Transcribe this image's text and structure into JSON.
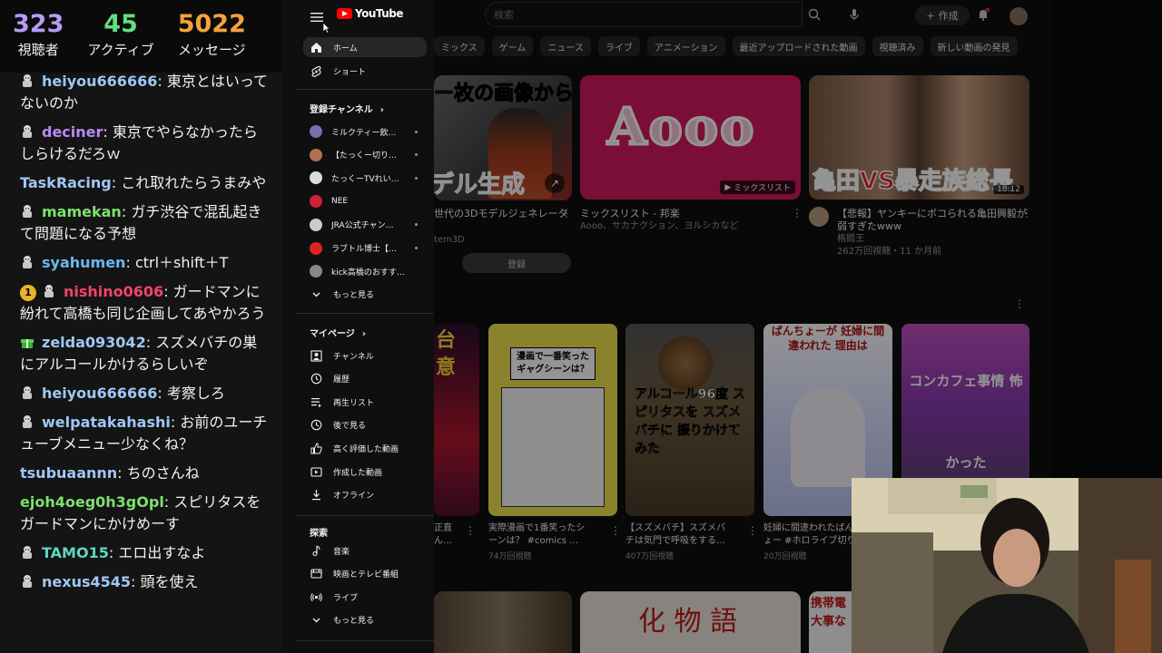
{
  "stats": [
    {
      "value": "323",
      "label": "視聴者",
      "color": "#b79af7"
    },
    {
      "value": "45",
      "label": "アクティブ",
      "color": "#5ee07f"
    },
    {
      "value": "5022",
      "label": "メッセージ",
      "color": "#f4a23c"
    }
  ],
  "chat": [
    {
      "user": "heiyou666666",
      "text": "東京とはいってないのか",
      "color": "#9fc7f5",
      "icon": "avatar"
    },
    {
      "user": "deciner",
      "text": "東京でやらなかったらしらけるだろｗ",
      "color": "#b88af5",
      "icon": "avatar"
    },
    {
      "user": "TaskRacing",
      "text": "これ取れたらうまみや",
      "color": "#9fc7f5",
      "icon": ""
    },
    {
      "user": "mamekan",
      "text": "ガチ渋谷で混乱起きて問題になる予想",
      "color": "#7ee06f",
      "icon": "avatar"
    },
    {
      "user": "syahumen",
      "text": "ctrl＋shift＋T",
      "color": "#6bb8f0",
      "icon": "avatar"
    },
    {
      "user": "nishino0606",
      "text": "ガードマンに紛れて高橋も同じ企画してあやかろう",
      "color": "#f0456a",
      "icon": "avatar",
      "badge": "1"
    },
    {
      "user": "zelda093042",
      "text": "スズメバチの巣にアルコールかけるらしいぞ",
      "color": "#9fc7f5",
      "icon": "gift"
    },
    {
      "user": "heiyou666666",
      "text": "考察しろ",
      "color": "#9fc7f5",
      "icon": "avatar"
    },
    {
      "user": "welpatakahashi",
      "text": "お前のユーチューブメニュー少なくね？",
      "color": "#9fc7f5",
      "icon": "avatar"
    },
    {
      "user": "tsubuaannn",
      "text": "ちのさんね",
      "color": "#9fc7f5",
      "icon": ""
    },
    {
      "user": "ejoh4oeg0h3gOpl",
      "text": "スピリタスをガードマンにかけめーす",
      "color": "#7ee06f",
      "icon": ""
    },
    {
      "user": "TAMO15",
      "text": "エロ出すなよ",
      "color": "#5fd6c2",
      "icon": "avatar"
    },
    {
      "user": "nexus4545",
      "text": "頭を使え",
      "color": "#9fc7f5",
      "icon": "avatar"
    }
  ],
  "youtube": {
    "logo_text": "YouTube",
    "search_placeholder": "検索",
    "create_label": "作成",
    "chips": [
      "ミックス",
      "ゲーム",
      "ニュース",
      "ライブ",
      "アニメーション",
      "最近アップロードされた動画",
      "視聴済み",
      "新しい動画の発見"
    ],
    "sidebar": {
      "home": "ホーム",
      "shorts": "ショート",
      "subs_header": "登録チャンネル",
      "channels": [
        {
          "name": "ミルクティー飲…",
          "color": "#7a6ea8",
          "live": true
        },
        {
          "name": "【たっくー切り…",
          "color": "#b07050",
          "live": true
        },
        {
          "name": "たっくーTVれい…",
          "color": "#dddddd",
          "live": true
        },
        {
          "name": "NEE",
          "color": "#cc2233",
          "live": false
        },
        {
          "name": "JRA公式チャン…",
          "color": "#cccccc",
          "live": true
        },
        {
          "name": "ラブトル博士【…",
          "color": "#dd2222",
          "live": true
        },
        {
          "name": "kick高橋のおすす…",
          "color": "#888888",
          "live": false
        }
      ],
      "more1": "もっと見る",
      "mypage_header": "マイページ",
      "mypage": [
        "チャンネル",
        "履歴",
        "再生リスト",
        "後で見る",
        "高く評価した動画",
        "作成した動画",
        "オフライン"
      ],
      "explore_header": "探索",
      "explore": [
        "音楽",
        "映画とテレビ番組",
        "ライブ",
        "もっと見る"
      ]
    },
    "videos": [
      {
        "title": "世代の3Dモデルジェネレータ",
        "meta": "tem3D",
        "thumb_text1": "ー枚の画像から",
        "thumb_text2": "デル生成"
      },
      {
        "title": "ミックスリスト - 邦楽",
        "meta": "Aooo、サカナクション、ヨルシカなど",
        "thumb_text": "Aooo",
        "badge": "ミックスリスト"
      },
      {
        "title": "【悲報】ヤンキーにボコられる亀田興毅が",
        "title2": "弱すぎたwww",
        "channel": "格闘王",
        "meta": "262万回視聴・11 か月前",
        "thumb_text": "亀田VS暴走族総長",
        "duration": "18:12"
      }
    ],
    "subscribe_label": "登録",
    "shorts": [
      {
        "title": "正直",
        "title2": "ん…",
        "views": "",
        "thumb_text": "台 意"
      },
      {
        "title": "実際漫画で1番笑ったシ",
        "title2": "ーンは？ #comics …",
        "views": "74万回視聴",
        "thumb_text": "漫画で一番笑った ギャグシーンは？"
      },
      {
        "title": "【スズメバチ】スズメバ",
        "title2": "チは気門で呼吸をする…",
        "views": "407万回視聴",
        "thumb_text": "アルコール96度 スピリタスを スズメバチに 振りかけてみた"
      },
      {
        "title": "妊婦に間違われたばん",
        "title2": "ょー #ホロライブ切り",
        "views": "20万回視聴",
        "thumb_text": "ばんちょーが 妊婦に間違われた 理由は"
      },
      {
        "title": "",
        "title2": "",
        "views": "",
        "thumb_text": "コンカフェ事情 怖かった"
      }
    ],
    "bottom_thumbs": [
      "化 物 語",
      "携帯電 大事な"
    ]
  }
}
